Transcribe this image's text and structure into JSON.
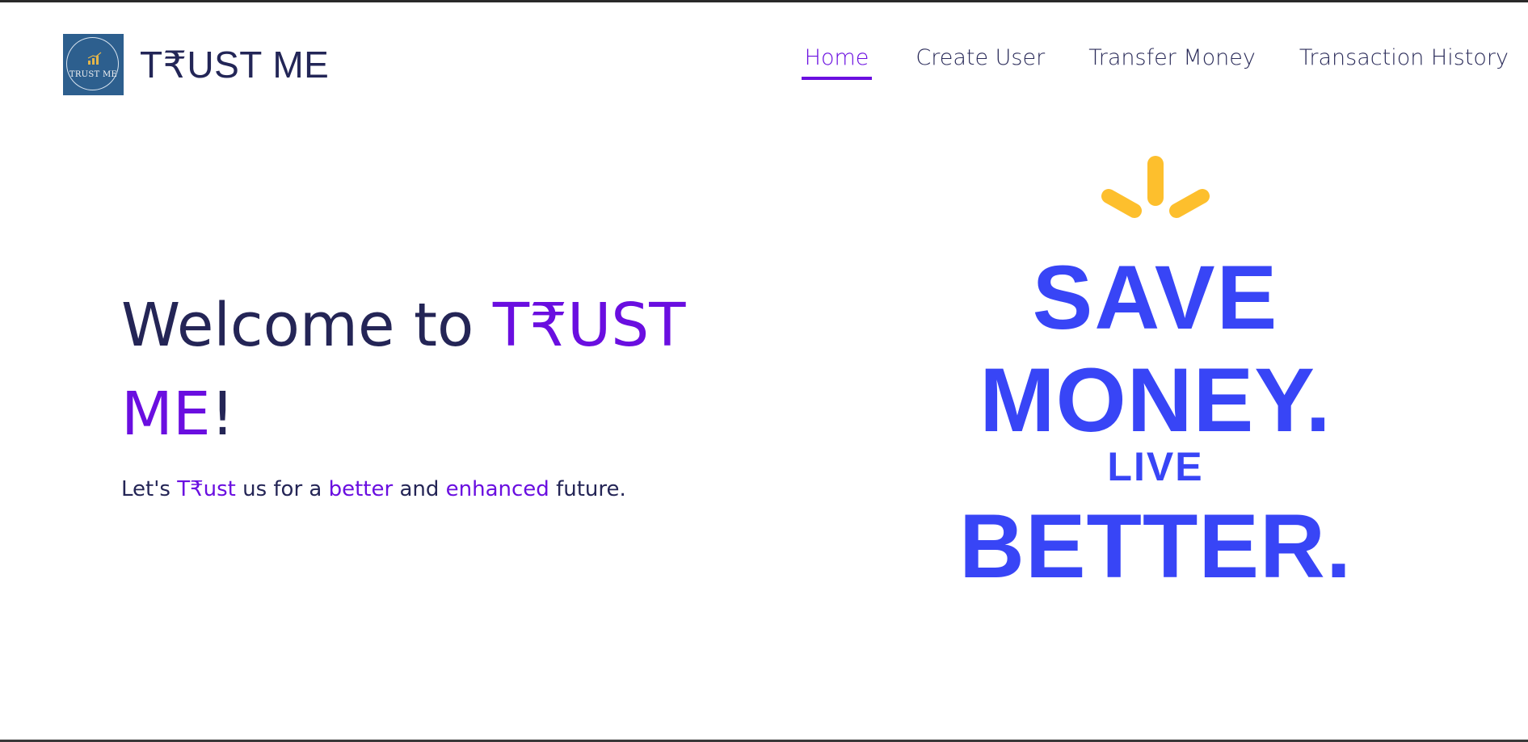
{
  "header": {
    "logo_text": "TRUST ME",
    "brand_name": "T₹UST ME",
    "nav": [
      {
        "label": "Home",
        "active": true
      },
      {
        "label": "Create User",
        "active": false
      },
      {
        "label": "Transfer Money",
        "active": false
      },
      {
        "label": "Transaction History",
        "active": false
      }
    ]
  },
  "hero": {
    "title_prefix": "Welcome to ",
    "title_brand": "T₹UST ME",
    "title_suffix": "!",
    "subtitle": {
      "p1": "Let's ",
      "trust": "T₹ust",
      "p2": " us for a ",
      "better": "better",
      "p3": " and ",
      "enhanced": "enhanced",
      "p4": " future."
    }
  },
  "poster": {
    "line1": "SAVE",
    "line2": "MONEY.",
    "line3": "LIVE",
    "line4": "BETTER."
  },
  "colors": {
    "accent_purple": "#6a0ee0",
    "navy_text": "#232657",
    "poster_blue": "#3845f6",
    "spark_yellow": "#fdbf2d",
    "logo_bg": "#2d5f8e"
  },
  "icons": {
    "logo": "trust-me-logo-icon",
    "sparks": "spark-rays-icon"
  }
}
